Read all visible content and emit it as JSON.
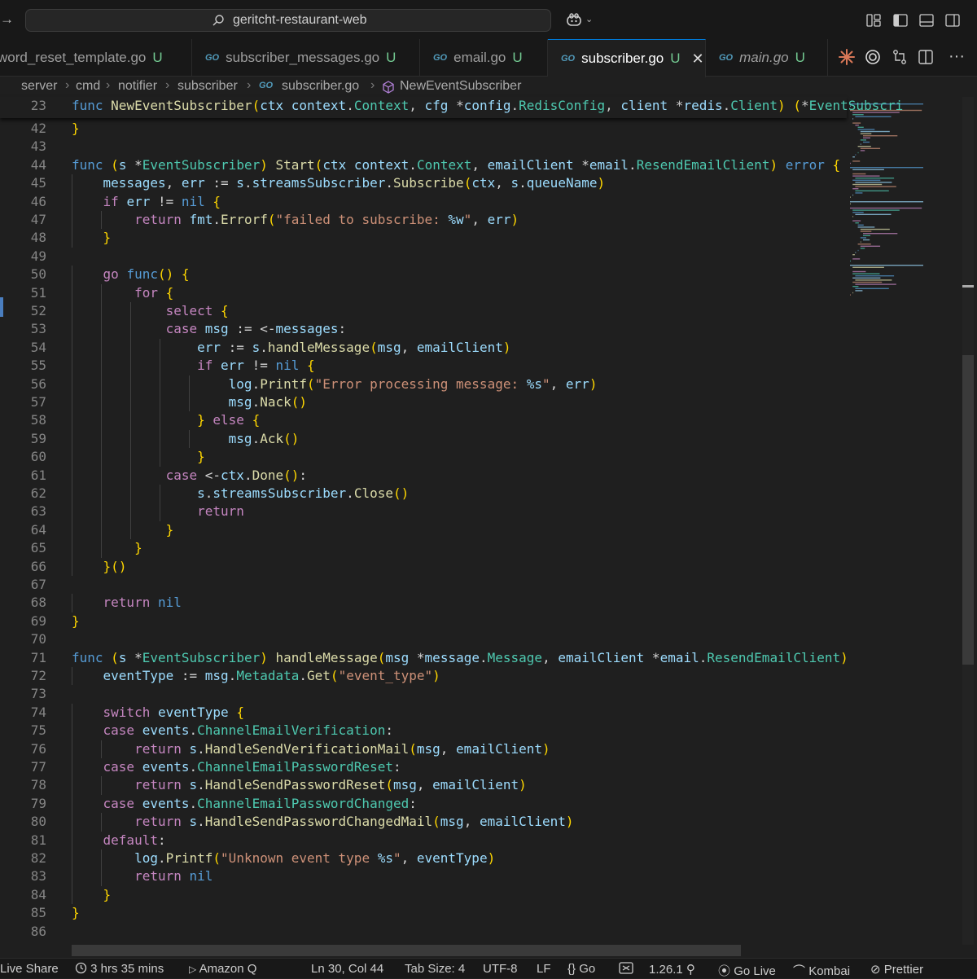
{
  "window": {
    "search_text": "geritcht-restaurant-web"
  },
  "tabs": [
    {
      "label": "word_reset_template.go",
      "status": "U",
      "active": false,
      "italic": false,
      "icon": "go-file-icon"
    },
    {
      "label": "subscriber_messages.go",
      "status": "U",
      "active": false,
      "italic": false,
      "icon": "go-file-icon"
    },
    {
      "label": "email.go",
      "status": "U",
      "active": false,
      "italic": false,
      "icon": "go-file-icon"
    },
    {
      "label": "subscriber.go",
      "status": "U",
      "active": true,
      "italic": false,
      "icon": "go-file-icon"
    },
    {
      "label": "main.go",
      "status": "U",
      "active": false,
      "italic": true,
      "icon": "go-file-icon"
    }
  ],
  "breadcrumb": [
    "server",
    "cmd",
    "notifier",
    "subscriber",
    "subscriber.go",
    "NewEventSubscriber"
  ],
  "sticky_line": {
    "number": "23",
    "text": "func NewEventSubscriber(ctx context.Context, cfg *config.RedisConfig, client *redis.Client) (*EventSubscri"
  },
  "code_lines": [
    {
      "n": "42",
      "t": "}"
    },
    {
      "n": "43",
      "t": ""
    },
    {
      "n": "44",
      "t": "func (s *EventSubscriber) Start(ctx context.Context, emailClient *email.ResendEmailClient) error {"
    },
    {
      "n": "45",
      "t": "    messages, err := s.streamsSubscriber.Subscribe(ctx, s.queueName)"
    },
    {
      "n": "46",
      "t": "    if err != nil {"
    },
    {
      "n": "47",
      "t": "        return fmt.Errorf(\"failed to subscribe: %w\", err)"
    },
    {
      "n": "48",
      "t": "    }"
    },
    {
      "n": "49",
      "t": ""
    },
    {
      "n": "50",
      "t": "    go func() {"
    },
    {
      "n": "51",
      "t": "        for {"
    },
    {
      "n": "52",
      "t": "            select {"
    },
    {
      "n": "53",
      "t": "            case msg := <-messages:"
    },
    {
      "n": "54",
      "t": "                err := s.handleMessage(msg, emailClient)"
    },
    {
      "n": "55",
      "t": "                if err != nil {"
    },
    {
      "n": "56",
      "t": "                    log.Printf(\"Error processing message: %s\", err)"
    },
    {
      "n": "57",
      "t": "                    msg.Nack()"
    },
    {
      "n": "58",
      "t": "                } else {"
    },
    {
      "n": "59",
      "t": "                    msg.Ack()"
    },
    {
      "n": "60",
      "t": "                }"
    },
    {
      "n": "61",
      "t": "            case <-ctx.Done():"
    },
    {
      "n": "62",
      "t": "                s.streamsSubscriber.Close()"
    },
    {
      "n": "63",
      "t": "                return"
    },
    {
      "n": "64",
      "t": "            }"
    },
    {
      "n": "65",
      "t": "        }"
    },
    {
      "n": "66",
      "t": "    }()"
    },
    {
      "n": "67",
      "t": ""
    },
    {
      "n": "68",
      "t": "    return nil"
    },
    {
      "n": "69",
      "t": "}"
    },
    {
      "n": "70",
      "t": ""
    },
    {
      "n": "71",
      "t": "func (s *EventSubscriber) handleMessage(msg *message.Message, emailClient *email.ResendEmailClient) error"
    },
    {
      "n": "72",
      "t": "    eventType := msg.Metadata.Get(\"event_type\")"
    },
    {
      "n": "73",
      "t": ""
    },
    {
      "n": "74",
      "t": "    switch eventType {"
    },
    {
      "n": "75",
      "t": "    case events.ChannelEmailVerification:"
    },
    {
      "n": "76",
      "t": "        return s.HandleSendVerificationMail(msg, emailClient)"
    },
    {
      "n": "77",
      "t": "    case events.ChannelEmailPasswordReset:"
    },
    {
      "n": "78",
      "t": "        return s.HandleSendPasswordReset(msg, emailClient)"
    },
    {
      "n": "79",
      "t": "    case events.ChannelEmailPasswordChanged:"
    },
    {
      "n": "80",
      "t": "        return s.HandleSendPasswordChangedMail(msg, emailClient)"
    },
    {
      "n": "81",
      "t": "    default:"
    },
    {
      "n": "82",
      "t": "        log.Printf(\"Unknown event type %s\", eventType)"
    },
    {
      "n": "83",
      "t": "        return nil"
    },
    {
      "n": "84",
      "t": "    }"
    },
    {
      "n": "85",
      "t": "}"
    },
    {
      "n": "86",
      "t": ""
    }
  ],
  "status": {
    "live_share": "Live Share",
    "time": "3 hrs 35 mins",
    "amazon_q": "Amazon Q",
    "position": "Ln 30, Col 44",
    "tab_size": "Tab Size: 4",
    "encoding": "UTF-8",
    "eol": "LF",
    "language": "Go",
    "go_version": "1.26.1",
    "go_live": "Go Live",
    "kombai": "Kombai",
    "prettier": "Prettier"
  },
  "colors": {
    "keyword": "#569cd6",
    "control": "#c586c0",
    "function": "#dcdcaa",
    "type": "#4ec9b0",
    "string": "#ce9178",
    "accent": "#0078d4"
  }
}
